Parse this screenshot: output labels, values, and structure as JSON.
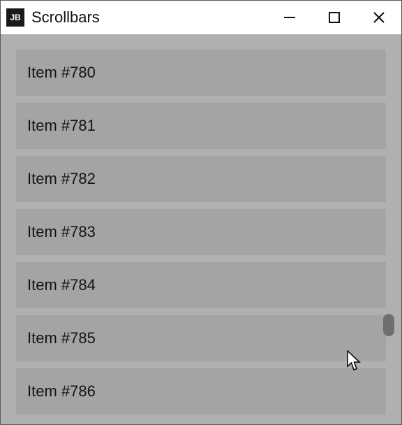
{
  "window": {
    "title": "Scrollbars",
    "icon_label": "JB"
  },
  "list": {
    "items": [
      {
        "label": "Item #780"
      },
      {
        "label": "Item #781"
      },
      {
        "label": "Item #782"
      },
      {
        "label": "Item #783"
      },
      {
        "label": "Item #784"
      },
      {
        "label": "Item #785"
      },
      {
        "label": "Item #786"
      }
    ]
  }
}
